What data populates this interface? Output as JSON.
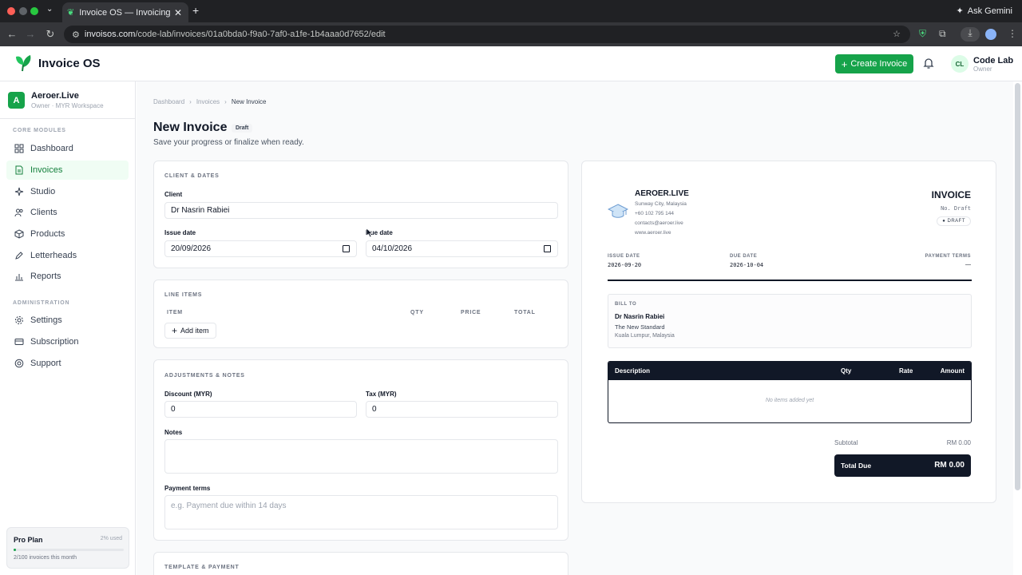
{
  "browser": {
    "tab_title": "Invoice OS — Invoicing & Bus",
    "url_host": "invoisos.com",
    "url_path": "/code-lab/invoices/01a0bda0-f9a0-7af0-a1fe-1b4aaa0d7652/edit",
    "ask_gemini": "Ask Gemini",
    "new_tab": "+"
  },
  "header": {
    "app_name": "Invoice OS",
    "create_label": "Create Invoice",
    "user_initials": "CL",
    "user_name": "Code Lab",
    "user_role": "Owner"
  },
  "sidebar": {
    "workspace_initial": "A",
    "workspace_name": "Aeroer.Live",
    "workspace_sub": "Owner · MYR Workspace",
    "core_label": "CORE MODULES",
    "admin_label": "ADMINISTRATION",
    "core_items": [
      {
        "label": "Dashboard",
        "icon": "grid-icon"
      },
      {
        "label": "Invoices",
        "icon": "file-icon",
        "active": true
      },
      {
        "label": "Studio",
        "icon": "sparkle-icon"
      },
      {
        "label": "Clients",
        "icon": "users-icon"
      },
      {
        "label": "Products",
        "icon": "box-icon"
      },
      {
        "label": "Letterheads",
        "icon": "pen-icon"
      },
      {
        "label": "Reports",
        "icon": "chart-icon"
      }
    ],
    "admin_items": [
      {
        "label": "Settings",
        "icon": "gear-icon"
      },
      {
        "label": "Subscription",
        "icon": "card-icon"
      },
      {
        "label": "Support",
        "icon": "help-icon"
      }
    ],
    "plan": {
      "name": "Pro Plan",
      "used": "2% used",
      "progress": 0.02,
      "count": "2/100 invoices this month"
    }
  },
  "page": {
    "breadcrumbs": [
      "Dashboard",
      "Invoices",
      "New Invoice"
    ],
    "title": "New Invoice",
    "status": "Draft",
    "subtitle": "Save your progress or finalize when ready."
  },
  "form": {
    "client_dates_label": "CLIENT & DATES",
    "client_label": "Client",
    "client_value": "Dr Nasrin Rabiei",
    "issue_label": "Issue date",
    "issue_value": "20/09/2026",
    "due_label": "Due date",
    "due_value": "04/10/2026",
    "line_items_label": "LINE ITEMS",
    "col_item": "ITEM",
    "col_qty": "QTY",
    "col_price": "PRICE",
    "col_total": "TOTAL",
    "add_item": "Add item",
    "adjustments_label": "ADJUSTMENTS & NOTES",
    "discount_label": "Discount (MYR)",
    "discount_value": "0",
    "tax_label": "Tax (MYR)",
    "tax_value": "0",
    "notes_label": "Notes",
    "notes_value": "",
    "terms_label": "Payment terms",
    "terms_placeholder": "e.g. Payment due within 14 days",
    "template_label": "TEMPLATE & PAYMENT"
  },
  "preview": {
    "company": "AEROER.LIVE",
    "address": "Sunway City, Malaysia",
    "phone": "+60 102 795 144",
    "email": "contacts@aeroer.live",
    "website": "www.aeroer.live",
    "doc_title": "INVOICE",
    "doc_no": "No. Draft",
    "status": "DRAFT",
    "issue_label": "ISSUE DATE",
    "issue_value": "2026-09-20",
    "due_label": "DUE DATE",
    "due_value": "2026-10-04",
    "terms_label": "PAYMENT TERMS",
    "terms_value": "—",
    "bill_to_label": "BILL TO",
    "bill_name": "Dr Nasrin Rabiei",
    "bill_org": "The New Standard",
    "bill_city": "Kuala Lumpur, Malaysia",
    "col_desc": "Description",
    "col_qty": "Qty",
    "col_rate": "Rate",
    "col_amount": "Amount",
    "empty": "No items added yet",
    "subtotal_label": "Subtotal",
    "subtotal_value": "RM 0.00",
    "total_label": "Total Due",
    "total_value": "RM 0.00"
  },
  "colors": {
    "brand": "#16a34a",
    "dark": "#111827"
  }
}
